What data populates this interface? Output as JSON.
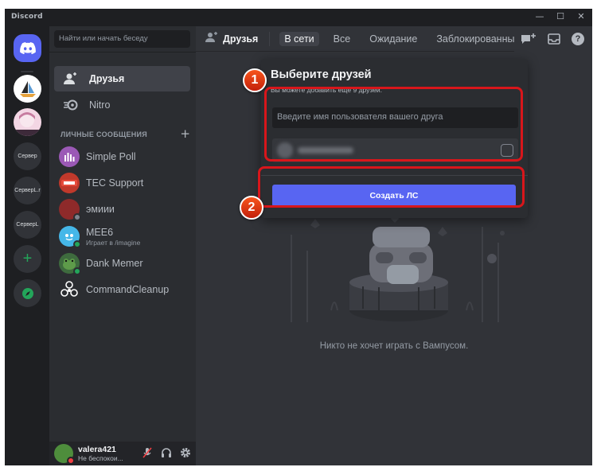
{
  "app": {
    "title": "Discord"
  },
  "window_controls": {
    "minimize": "—",
    "maximize": "☐",
    "close": "✕"
  },
  "servers": [
    {
      "label": "",
      "icon": "discord-logo-icon"
    },
    {
      "label": "",
      "icon": "sailboat-server-icon"
    },
    {
      "label": "",
      "icon": "anime-server-icon"
    },
    {
      "label": "Сервер"
    },
    {
      "label": "СерверL.r"
    },
    {
      "label": "СерверL"
    },
    {
      "label": "+",
      "icon": "add-server-icon"
    },
    {
      "label": "",
      "icon": "compass-icon"
    }
  ],
  "sidebar": {
    "search_label": "Найти или начать беседу",
    "items": [
      {
        "label": "Друзья",
        "icon": "friends-icon"
      },
      {
        "label": "Nitro",
        "icon": "nitro-icon"
      }
    ],
    "dm_header": "ЛИЧНЫЕ СООБЩЕНИЯ",
    "dm_add": "+",
    "dms": [
      {
        "name": "Simple Poll",
        "sub": "",
        "color": "#9b59b6"
      },
      {
        "name": "TEC Support",
        "sub": "",
        "color": "#c0392b"
      },
      {
        "name": "эмиии",
        "sub": "",
        "color": "#8e2a2a"
      },
      {
        "name": "MEE6",
        "sub": "Играет в /imagine",
        "color": "#45b7e8"
      },
      {
        "name": "Dank Memer",
        "sub": "",
        "color": "#3e6b3e"
      },
      {
        "name": "CommandCleanup",
        "sub": "",
        "color": "#2b2d31"
      }
    ]
  },
  "user": {
    "name": "valera421",
    "status": "Не беспокои..."
  },
  "topbar": {
    "friends_label": "Друзья",
    "tabs": [
      "В сети",
      "Все",
      "Ожидание",
      "Заблокированные"
    ]
  },
  "main": {
    "empty_text": "Никто не хочет играть с Вампусом."
  },
  "popup": {
    "title": "Выберите друзей",
    "subtitle": "Вы можете добавить ещё 9 друзей.",
    "input_placeholder": "Введите имя пользователя вашего друга",
    "button_label": "Создать ЛС"
  },
  "annotations": [
    {
      "label": "1"
    },
    {
      "label": "2"
    }
  ],
  "colors": {
    "accent": "#5865f2",
    "highlight": "#d8161b",
    "online": "#23a55a",
    "dnd": "#f23f43"
  }
}
